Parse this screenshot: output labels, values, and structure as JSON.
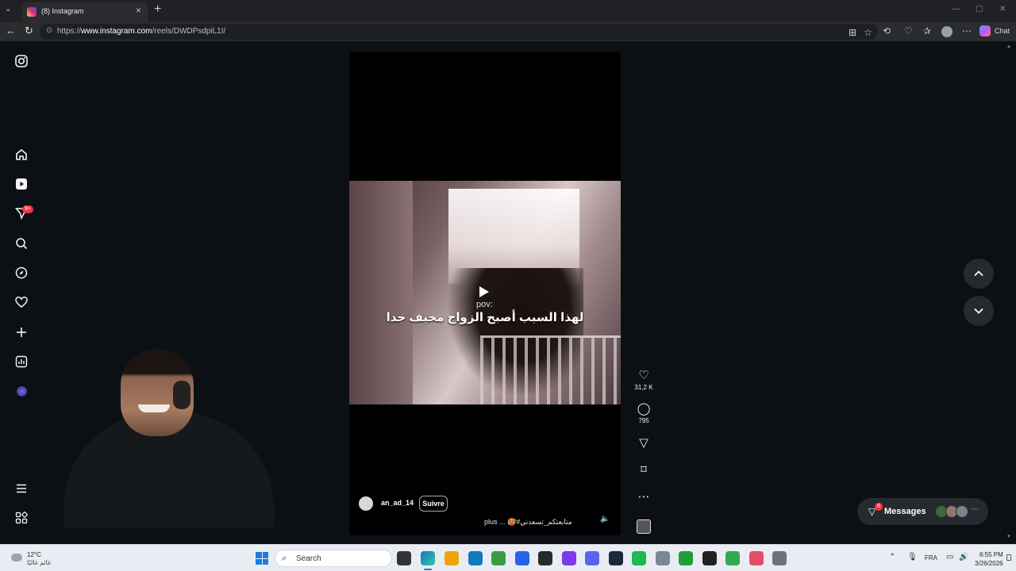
{
  "browser": {
    "tab_title": "(8) Instagram",
    "url_prefix": "https://",
    "url_host": "www.instagram.com",
    "url_path": "/reels/DWDPsdpiL1I/",
    "chat_label": "Chat",
    "accent": "#ff3040"
  },
  "sidebar": {
    "notification_badge": "9+",
    "items": [
      "instagram-logo",
      "home-icon",
      "reels-icon",
      "messages-icon",
      "search-icon",
      "explore-icon",
      "heart-icon",
      "create-icon",
      "dashboard-icon",
      "profile-avatar",
      "menu-icon",
      "more-apps-icon"
    ]
  },
  "reel": {
    "pov": "pov:",
    "overlay_text": "لهذا السبب أصبح الزواج مخيف جدا",
    "author": "an_ad_14",
    "follow": "Suivre",
    "caption": "plus ... 🥵#متابعتكم_تسعدني",
    "likes": "31,2 K",
    "comments": "795"
  },
  "messages": {
    "label": "Messages",
    "badge": "8"
  },
  "taskbar": {
    "weather_temp": "12°C",
    "weather_desc": "غائم غالبًا",
    "search_placeholder": "Search",
    "lang": "FRA",
    "time": "6:55 PM",
    "date": "3/26/2026",
    "app_colors": [
      "#f0a30a",
      "#0f7bbf",
      "#3a9b43",
      "#2563eb",
      "#2a2a2a",
      "#7c3aed",
      "#5865f2",
      "#1b2838",
      "#1db954",
      "#7b8794",
      "#1e9e3a",
      "#222222",
      "#34a853",
      "#e44c6a",
      "#6b7280"
    ]
  }
}
